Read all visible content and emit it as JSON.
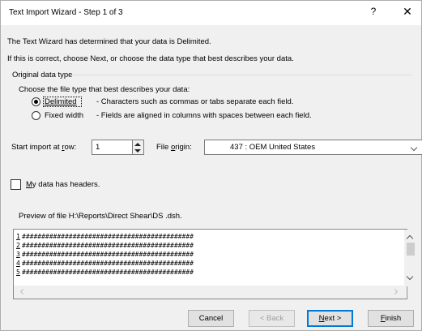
{
  "dialog": {
    "title": "Text Import Wizard - Step 1 of 3",
    "help_glyph": "?",
    "close_glyph": "✕"
  },
  "intro": {
    "line1": "The Text Wizard has determined that your data is Delimited.",
    "line2": "If this is correct, choose Next, or choose the data type that best describes your data."
  },
  "original_data_type": {
    "group_label": "Original data type",
    "prompt": "Choose the file type that best describes your data:",
    "options": [
      {
        "label": "Delimited",
        "description": "- Characters such as commas or tabs separate each field.",
        "selected": true
      },
      {
        "label": "Fixed width",
        "description": "- Fields are aligned in columns with spaces between each field.",
        "selected": false
      }
    ]
  },
  "start_import": {
    "label_pre": "Start import at ",
    "label_acc": "r",
    "label_post": "ow:",
    "value": "1"
  },
  "file_origin": {
    "label_pre": "File ",
    "label_acc": "o",
    "label_post": "rigin:",
    "value": "437 : OEM United States"
  },
  "headers_checkbox": {
    "label_acc": "M",
    "label_rest": "y data has headers.",
    "checked": false
  },
  "preview": {
    "label": "Preview of file H:\\Reports\\Direct Shear\\DS  .dsh.",
    "rows": [
      {
        "num": "1",
        "text": "############################################"
      },
      {
        "num": "2",
        "text": "############################################"
      },
      {
        "num": "3",
        "text": "############################################"
      },
      {
        "num": "4",
        "text": "############################################"
      },
      {
        "num": "5",
        "text": "############################################"
      }
    ]
  },
  "buttons": {
    "cancel": "Cancel",
    "back": "< Back",
    "next_acc": "N",
    "next_rest": "ext >",
    "finish_acc": "F",
    "finish_rest": "inish"
  },
  "colors": {
    "accent": "#0078d7",
    "window_bg": "#f0f0f0"
  }
}
